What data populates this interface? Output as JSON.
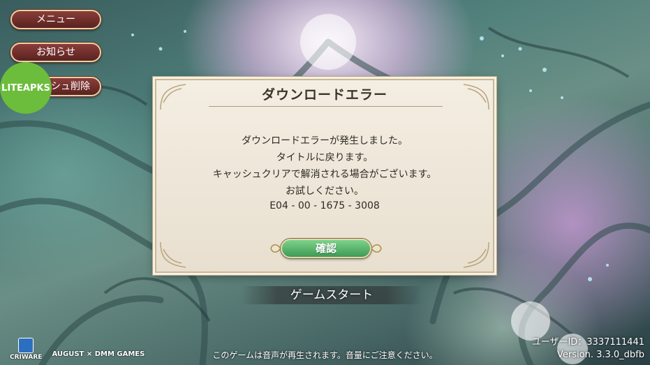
{
  "menu": {
    "menu_label": "メニュー",
    "notice_label": "お知らせ",
    "cache_delete_label": "シュ削除"
  },
  "watermark": {
    "label": "LITEAPKS"
  },
  "dialog": {
    "title": "ダウンロードエラー",
    "lines": [
      "ダウンロードエラーが発生しました。",
      "タイトルに戻ります。",
      "キャッシュクリアで解消される場合がございます。",
      "お試しください。",
      "E04 - 00 - 1675 - 3008"
    ],
    "confirm_label": "確認"
  },
  "game_start_label": "ゲームスタート",
  "footer": {
    "notice": "このゲームは音声が再生されます。音量にご注意ください。",
    "user_id": "ユーザーID：3337111441",
    "version": "Version. 3.3.0_dbfb",
    "logo_criware": "CRIWARE",
    "logo_publishers": "AUGUST × DMM GAMES"
  },
  "colors": {
    "menu_button": "#6f2e2b",
    "confirm_button": "#4fae64",
    "dialog_bg": "#f1ebdf"
  }
}
